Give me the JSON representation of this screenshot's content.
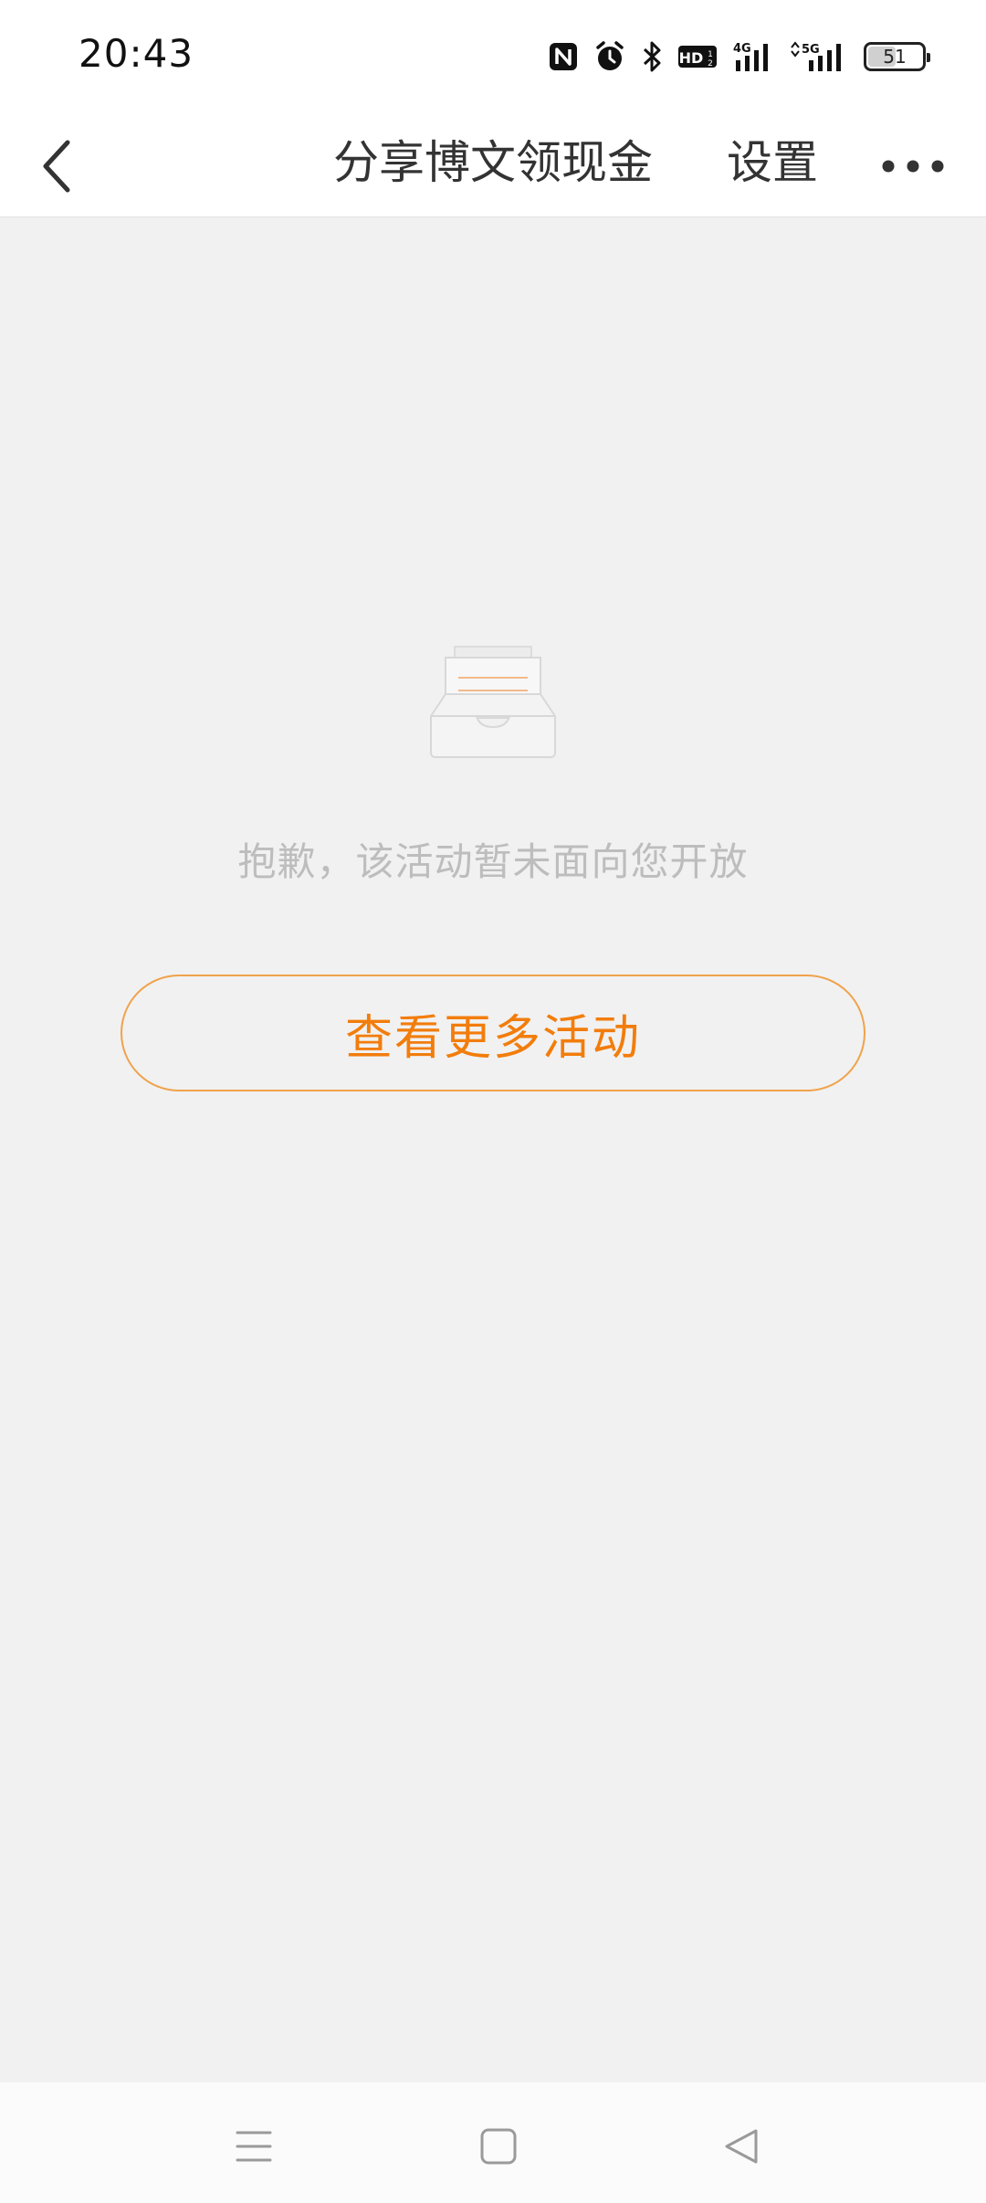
{
  "status_bar": {
    "time": "20:43",
    "icons": [
      "nfc-icon",
      "alarm-icon",
      "bluetooth-icon",
      "hd-voice-icon",
      "signal-4g-icon",
      "signal-5g-icon"
    ],
    "hd_label": "HD",
    "net_4g": "4G",
    "net_5g": "5G",
    "battery": {
      "level_percent": 51,
      "label": "51"
    }
  },
  "header": {
    "title": "分享博文领现金",
    "settings_label": "设置",
    "back_icon": "chevron-left-icon",
    "more_icon": "more-dots-icon"
  },
  "empty_state": {
    "illustration": "empty-inbox-icon",
    "message": "抱歉，该活动暂未面向您开放",
    "button_label": "查看更多活动"
  },
  "colors": {
    "accent": "#f27d0c",
    "button_border": "#f0a24a",
    "background": "#f1f1f1",
    "message_text": "#bdbdbd"
  },
  "nav_bar": {
    "items": [
      "menu-icon",
      "home-icon",
      "back-icon"
    ]
  }
}
